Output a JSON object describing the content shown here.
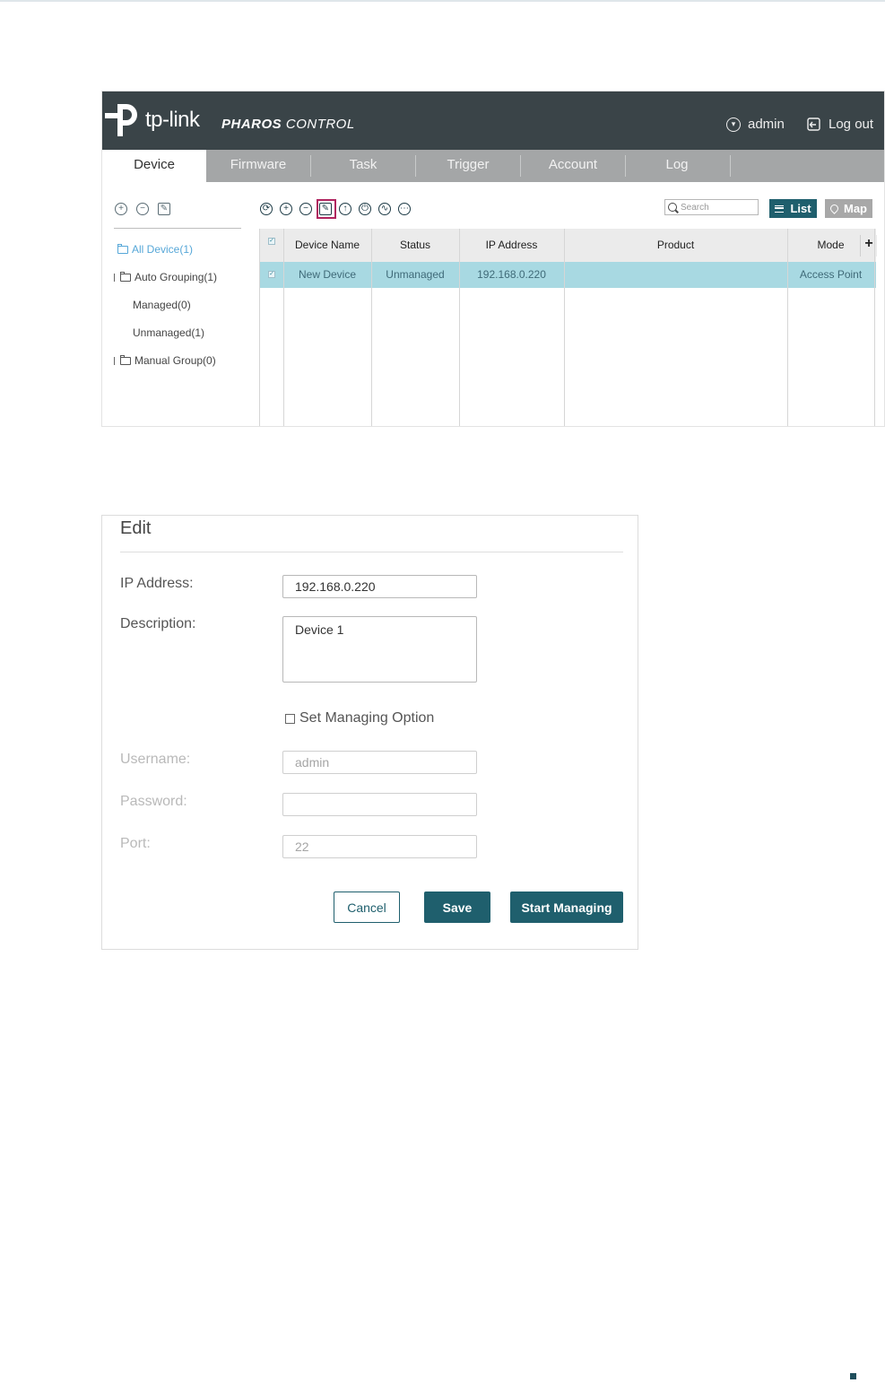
{
  "header": {
    "brand": "tp-link",
    "app_name_bold": "PHAROS",
    "app_name_light": "CONTROL",
    "user": "admin",
    "logout": "Log out"
  },
  "tabs": [
    {
      "label": "Device",
      "active": true
    },
    {
      "label": "Firmware"
    },
    {
      "label": "Task"
    },
    {
      "label": "Trigger"
    },
    {
      "label": "Account"
    },
    {
      "label": "Log"
    }
  ],
  "sidebar": {
    "items": [
      {
        "label": "All Device(1)",
        "active": true
      },
      {
        "label": "Auto Grouping(1)"
      },
      {
        "label": "Managed(0)"
      },
      {
        "label": "Unmanaged(1)"
      },
      {
        "label": "Manual Group(0)"
      }
    ]
  },
  "toolbar": {
    "search_placeholder": "Search",
    "list_label": "List",
    "map_label": "Map"
  },
  "table": {
    "columns": [
      "Device Name",
      "Status",
      "IP Address",
      "Product",
      "Mode"
    ],
    "rows": [
      {
        "device_name": "New Device",
        "status": "Unmanaged",
        "ip": "192.168.0.220",
        "product": "",
        "mode": "Access Point",
        "selected": true
      }
    ]
  },
  "edit": {
    "title": "Edit",
    "ip_label": "IP Address:",
    "ip_value": "192.168.0.220",
    "desc_label": "Description:",
    "desc_value": "Device 1",
    "managing_option": "Set Managing Option",
    "username_label": "Username:",
    "username_value": "admin",
    "password_label": "Password:",
    "password_value": "",
    "port_label": "Port:",
    "port_value": "22",
    "cancel": "Cancel",
    "save": "Save",
    "start": "Start Managing"
  },
  "colors": {
    "header_bg": "#3a4448",
    "accent": "#1f5f6d",
    "selected_row": "#a8d9e2",
    "highlight": "#b0245f"
  }
}
